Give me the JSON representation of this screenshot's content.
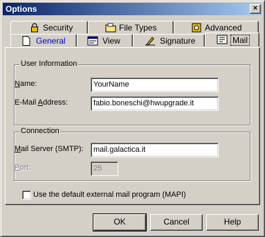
{
  "window": {
    "title": "Options",
    "close_glyph": "×"
  },
  "tabs_back": [
    {
      "label": "Security",
      "icon": "lock-icon"
    },
    {
      "label": "File Types",
      "icon": "folder-icon"
    },
    {
      "label": "Advanced",
      "icon": "gear-icon"
    }
  ],
  "tabs_front": [
    {
      "label": "General",
      "icon": "document-icon"
    },
    {
      "label": "View",
      "icon": "window-icon"
    },
    {
      "label": "Signature",
      "icon": "pen-icon"
    },
    {
      "label": "Mail",
      "icon": "mail-icon",
      "active": true
    }
  ],
  "user_info": {
    "title": "User Information",
    "name_label": "Name:",
    "name_value": "YourName",
    "email_label": "E-Mail Address:",
    "email_value": "fabio.boneschi@hwupgrade.it"
  },
  "connection": {
    "title": "Connection",
    "server_label": "Mail Server (SMTP):",
    "server_value": "mail.galactica.it",
    "port_label": "Port:",
    "port_value": "25"
  },
  "mapi": {
    "label": "Use the default external mail program (MAPI)",
    "checked": false
  },
  "buttons": {
    "ok": "OK",
    "cancel": "Cancel",
    "help": "Help"
  },
  "colors": {
    "title_start": "#0a246a",
    "title_end": "#a6caf0",
    "face": "#d4d0c8",
    "active_tab_text": "#0000cc"
  }
}
